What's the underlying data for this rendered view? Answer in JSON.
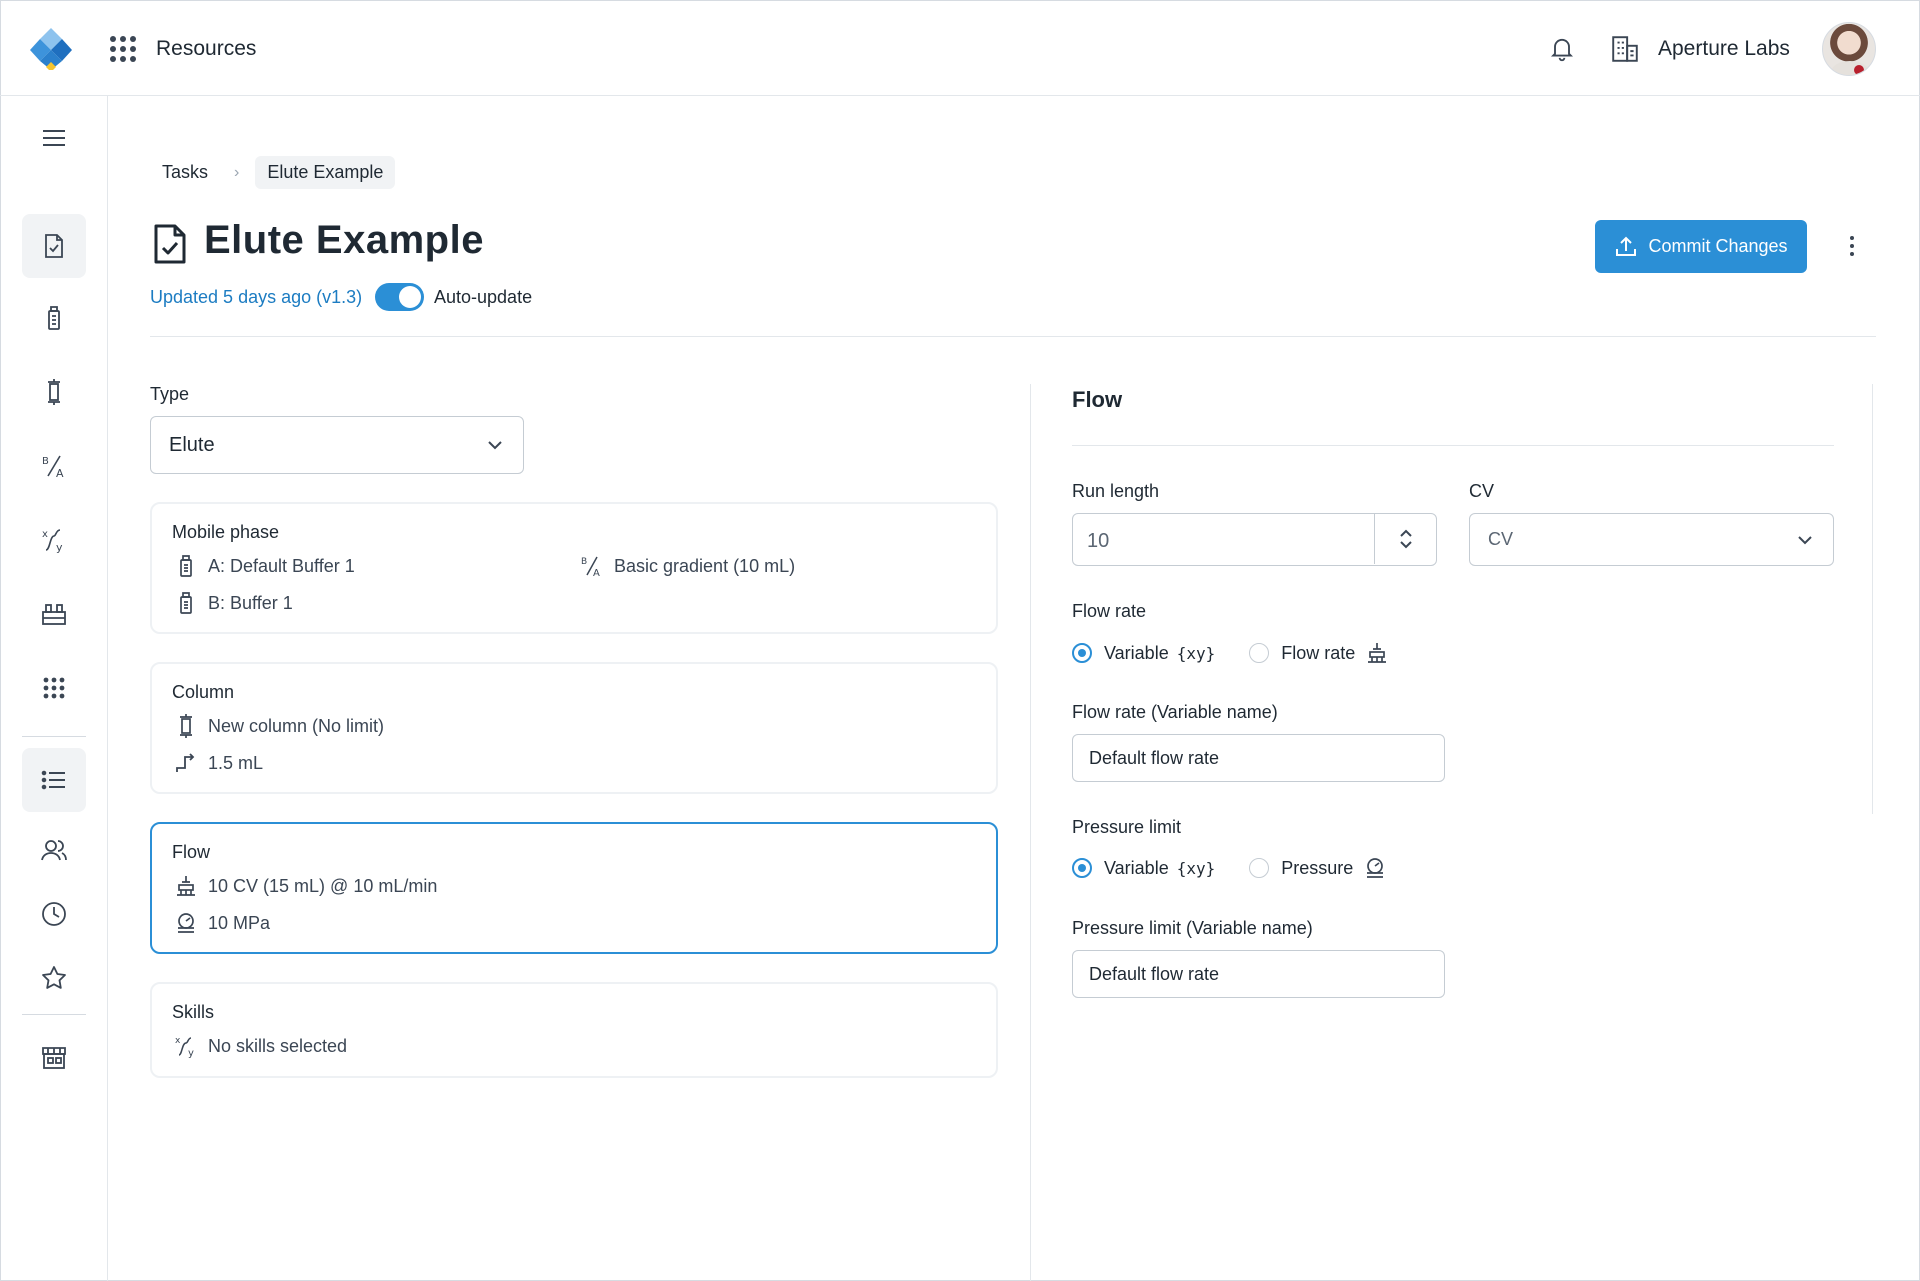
{
  "topbar": {
    "title": "Resources",
    "org_name": "Aperture Labs"
  },
  "breadcrumb": {
    "items": [
      "Tasks",
      "Elute Example"
    ]
  },
  "header": {
    "title": "Elute Example",
    "updated": "Updated 5 days ago (v1.3)",
    "auto_update_label": "Auto-update",
    "auto_update_on": true,
    "commit_label": "Commit Changes"
  },
  "type": {
    "label": "Type",
    "value": "Elute"
  },
  "cards": {
    "mobile_phase": {
      "title": "Mobile phase",
      "buffer_a": "A: Default Buffer 1",
      "buffer_b": "B: Buffer 1",
      "gradient": "Basic gradient (10 mL)"
    },
    "column": {
      "title": "Column",
      "name": "New column (No limit)",
      "volume": "1.5 mL"
    },
    "flow": {
      "title": "Flow",
      "rate": "10 CV (15 mL) @ 10 mL/min",
      "pressure": "10 MPa"
    },
    "skills": {
      "title": "Skills",
      "value": "No skills selected"
    }
  },
  "flow_panel": {
    "title": "Flow",
    "run_length_label": "Run length",
    "run_length_value": "10",
    "cv_label": "CV",
    "cv_value": "CV",
    "flow_rate_label": "Flow rate",
    "flow_rate_options": [
      "Variable",
      "Flow rate"
    ],
    "flow_rate_selected": "Variable",
    "flow_rate_var_label": "Flow rate (Variable name)",
    "flow_rate_var_value": "Default flow rate",
    "pressure_label": "Pressure limit",
    "pressure_options": [
      "Variable",
      "Pressure"
    ],
    "pressure_selected": "Variable",
    "pressure_var_label": "Pressure limit (Variable name)",
    "pressure_var_value": "Default flow rate",
    "variable_token": "{xy}"
  },
  "colors": {
    "accent": "#2b8fd6",
    "link": "#1c7cc2",
    "text": "#1f2933",
    "border": "#c5ccd3"
  }
}
